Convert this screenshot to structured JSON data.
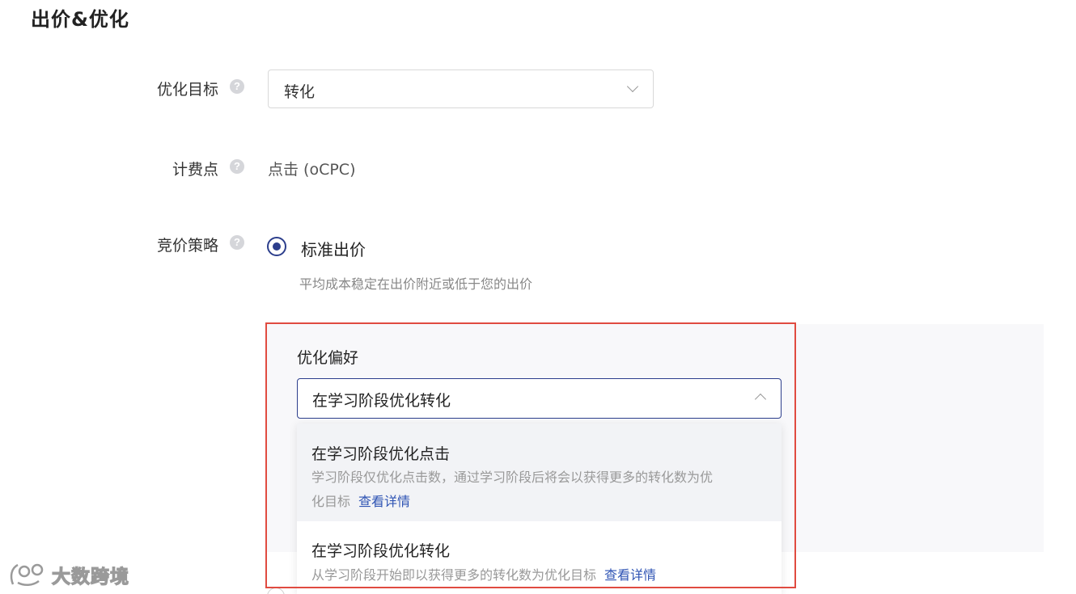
{
  "section": {
    "title": "出价&优化"
  },
  "optimization_goal": {
    "label": "优化目标",
    "value": "转化"
  },
  "billing_point": {
    "label": "计费点",
    "value": "点击 (oCPC)"
  },
  "bid_strategy": {
    "label": "竞价策略",
    "option_label": "标准出价",
    "option_desc": "平均成本稳定在出价附近或低于您的出价",
    "selected": true
  },
  "optimization_preference": {
    "label": "优化偏好",
    "value": "在学习阶段优化转化",
    "options": [
      {
        "title": "在学习阶段优化点击",
        "desc_line1": "学习阶段仅优化点击数，通过学习阶段后将会以获得更多的转化数为优",
        "desc_line2": "化目标",
        "link": "查看详情"
      },
      {
        "title": "在学习阶段优化转化",
        "desc_line1": "从学习阶段开始即以获得更多的转化数为优化目标",
        "link": "查看详情"
      }
    ]
  },
  "help_icon_glyph": "?",
  "watermark": {
    "text": "大数跨境"
  },
  "colors": {
    "accent": "#2c3e8c",
    "link": "#2f54b4",
    "highlight_border": "#e04b40",
    "panel_bg": "#f8f8fa"
  }
}
